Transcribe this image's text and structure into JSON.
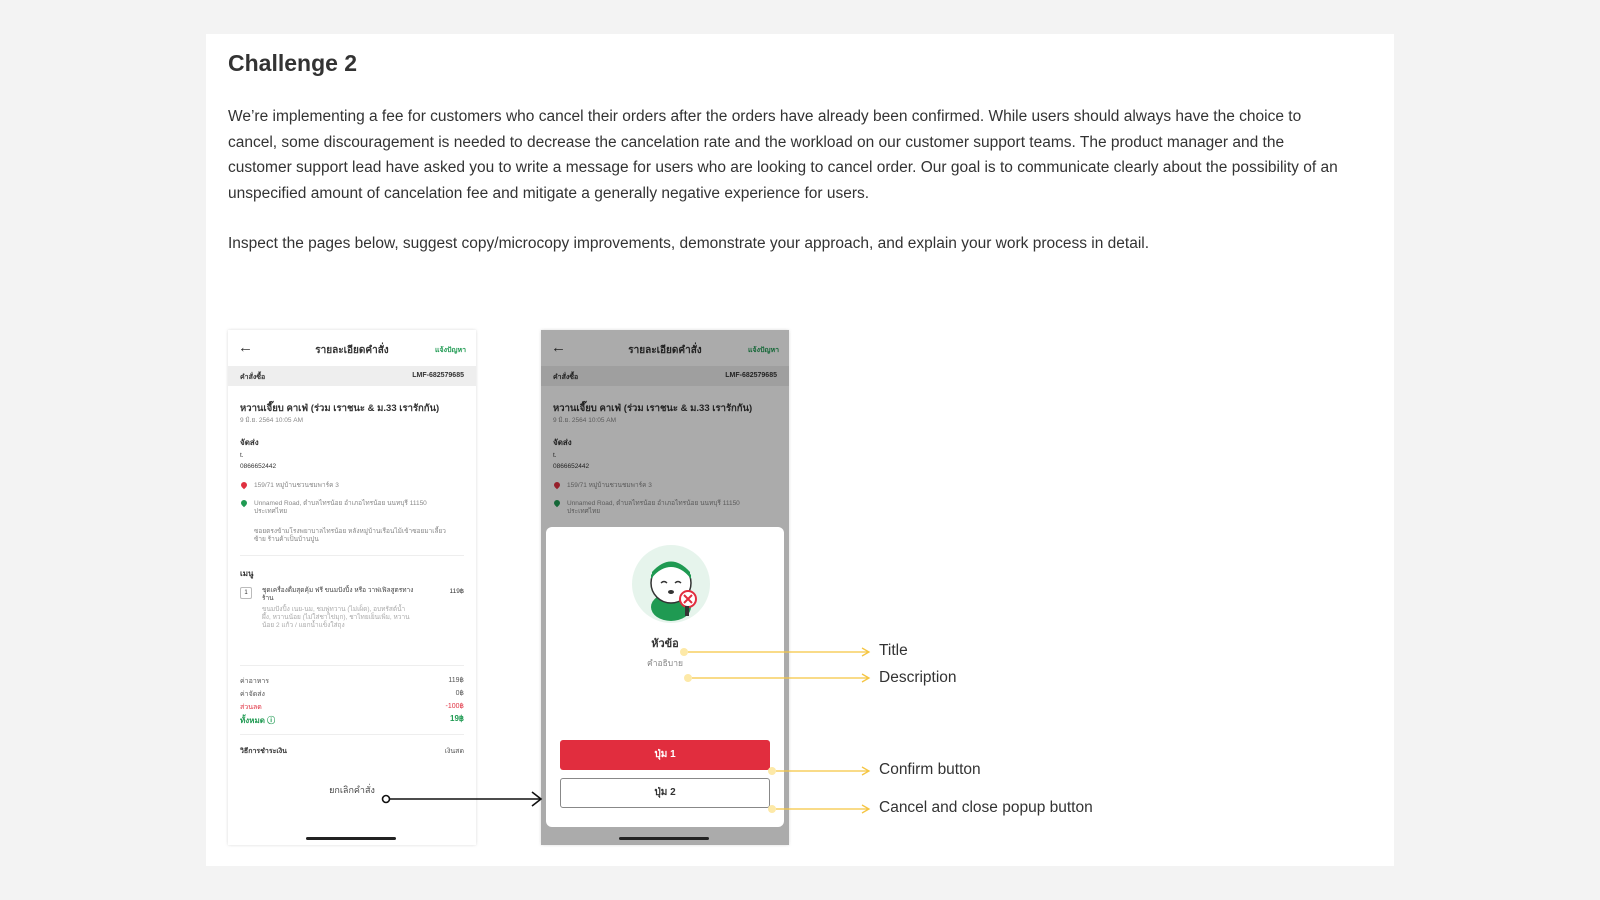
{
  "heading": "Challenge 2",
  "paragraph1": "We’re implementing a fee for customers who cancel their orders after the orders have already been confirmed. While users should always have the choice to cancel, some discouragement is needed to decrease the cancelation rate and the workload on our customer support teams. The product manager and the customer support lead have asked you to write a message for users who are looking to cancel order. Our goal is to communicate clearly about the possibility of an unspecified amount of cancelation fee and mitigate a generally negative experience for users.",
  "paragraph2": "Inspect the pages below, suggest copy/microcopy improvements, demonstrate your approach, and explain your work process in detail.",
  "phone": {
    "back": "←",
    "header_title": "รายละเอียดคำสั่ง",
    "help": "แจ้งปัญหา",
    "order_label": "คำสั่งซื้อ",
    "order_id": "LMF-682579685",
    "shop_name": "หวานเจี๊ยบ คาเฟ่ (ร่วม เราชนะ & ม.33 เรารักกัน)",
    "date": "9 มิ.ย. 2564 10:05 AM",
    "delivery_label": "จัดส่ง",
    "customer_name": "t.",
    "phone_number": "0866652442",
    "address1": "159/71 หมู่บ้านชวนชมพาร์ค 3",
    "address2": "Unnamed Road, ตำบลไทรน้อย อำเภอไทรน้อย นนทบุรี 11150 ประเทศไทย",
    "note": "ซอยตรงข้ามโรงพยาบาลไทรน้อย หลังหมู่บ้านเรือนไม้เข้าซอยมาเลี้ยวซ้าย ร้านค้าเป็นบ้านปูน",
    "menu_label": "เมนู",
    "item_qty": "1",
    "item_name": "ชุดเครื่องดื่มสุดคุ้ม ฟรี ขนมปังปิ้ง หรือ วาฟเฟิลสูตรทางร้าน",
    "item_details": "ขนมปังปิ้ง เนย-นม, ชมพู่ทวาน (ไม่เผ็ด), อบทรัสต์น้ำผึ้ง, หวานน้อย (ไม่ใส่ชาไข่มุก), ชาไทยเย็นเพิ่ม, หวานน้อย 2 แก้ว / แยกน้ำแข็งใส่ถุง",
    "item_price": "119฿",
    "food_label": "ค่าอาหาร",
    "food_value": "119฿",
    "delivery_fee_label": "ค่าจัดส่ง",
    "delivery_fee_value": "0฿",
    "discount_label": "ส่วนลด",
    "discount_value": "-100฿",
    "total_label": "ทั้งหมด ⓘ",
    "total_value": "19฿",
    "payment_label": "วิธีการชำระเงิน",
    "payment_value": "เงินสด",
    "cancel_order": "ยกเลิกคำสั่ง"
  },
  "modal": {
    "title": "หัวข้อ",
    "description": "คำอธิบาย",
    "button1": "ปุ่ม 1",
    "button2": "ปุ่ม 2"
  },
  "annotations": {
    "title": "Title",
    "description": "Description",
    "confirm": "Confirm button",
    "cancel_close": "Cancel and close popup button"
  },
  "colors": {
    "brand_green": "#1f9a52",
    "button_red": "#e12d3e",
    "annotation_line": "#f5c542"
  }
}
